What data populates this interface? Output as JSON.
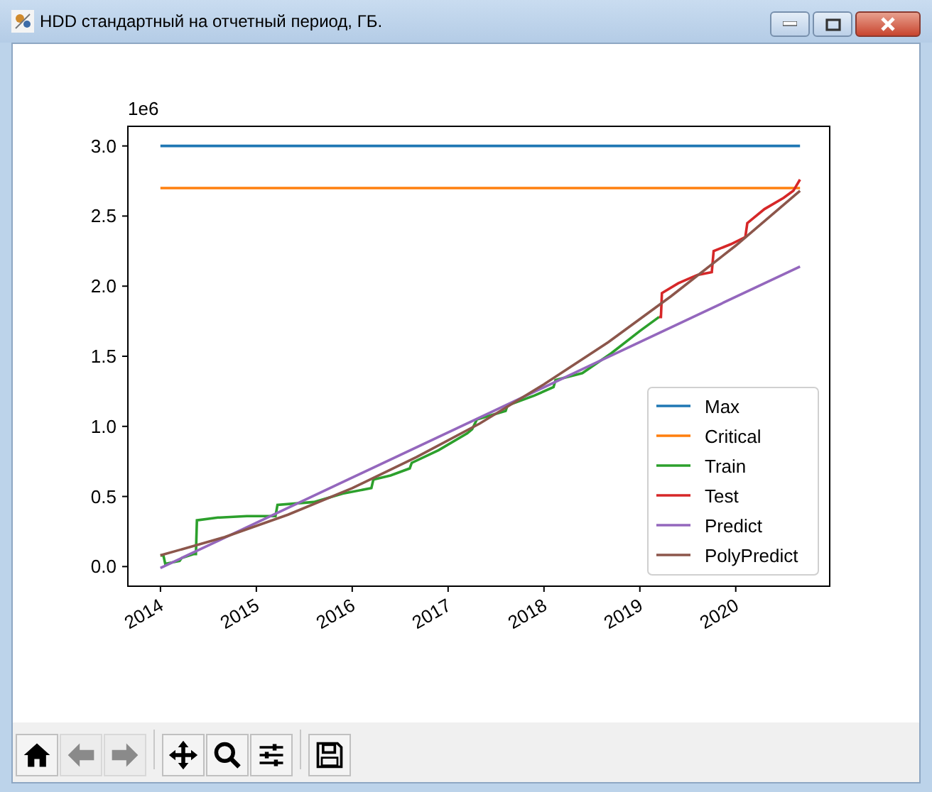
{
  "window": {
    "title": "HDD стандартный на отчетный период, ГБ."
  },
  "figure": {
    "offset_label": "1e6",
    "chart_data": {
      "type": "line",
      "xlim": [
        2013.66,
        2020.98
      ],
      "ylim": [
        -0.14,
        3.14
      ],
      "xticks": [
        {
          "value": 2014,
          "label": "2014"
        },
        {
          "value": 2015,
          "label": "2015"
        },
        {
          "value": 2016,
          "label": "2016"
        },
        {
          "value": 2017,
          "label": "2017"
        },
        {
          "value": 2018,
          "label": "2018"
        },
        {
          "value": 2019,
          "label": "2019"
        },
        {
          "value": 2020,
          "label": "2020"
        }
      ],
      "yticks": [
        {
          "value": 0,
          "label": "0.0"
        },
        {
          "value": 0.5,
          "label": "0.5"
        },
        {
          "value": 1,
          "label": "1.0"
        },
        {
          "value": 1.5,
          "label": "1.5"
        },
        {
          "value": 2,
          "label": "2.0"
        },
        {
          "value": 2.5,
          "label": "2.5"
        },
        {
          "value": 3,
          "label": "3.0"
        }
      ],
      "legend": true,
      "series": [
        {
          "name": "Max",
          "color": "#1f77b4",
          "x": [
            2014,
            2020.67
          ],
          "values": [
            3.0,
            3.0
          ]
        },
        {
          "name": "Critical",
          "color": "#ff7f0e",
          "x": [
            2014,
            2020.67
          ],
          "values": [
            2.7,
            2.7
          ]
        },
        {
          "name": "Train",
          "color": "#2ca02c",
          "x": [
            2014,
            2014.03,
            2014.05,
            2014.2,
            2014.22,
            2014.35,
            2014.37,
            2014.38,
            2014.6,
            2014.62,
            2014.9,
            2014.92,
            2015.2,
            2015.22,
            2015.6,
            2015.9,
            2016.2,
            2016.22,
            2016.4,
            2016.6,
            2016.62,
            2016.9,
            2017.2,
            2017.25,
            2017.3,
            2017.6,
            2017.62,
            2017.9,
            2018.1,
            2018.12,
            2018.4,
            2018.7,
            2019.0,
            2019.2
          ],
          "values": [
            0.08,
            0.08,
            0.02,
            0.04,
            0.06,
            0.09,
            0.09,
            0.33,
            0.35,
            0.35,
            0.36,
            0.36,
            0.36,
            0.44,
            0.46,
            0.52,
            0.56,
            0.62,
            0.65,
            0.7,
            0.74,
            0.83,
            0.95,
            0.98,
            1.05,
            1.11,
            1.15,
            1.22,
            1.28,
            1.33,
            1.38,
            1.52,
            1.68,
            1.78
          ]
        },
        {
          "name": "Test",
          "color": "#d62728",
          "x": [
            2019.2,
            2019.22,
            2019.23,
            2019.4,
            2019.6,
            2019.75,
            2019.77,
            2019.95,
            2020.1,
            2020.12,
            2020.3,
            2020.5,
            2020.6,
            2020.67
          ],
          "values": [
            1.78,
            1.78,
            1.95,
            2.02,
            2.08,
            2.1,
            2.25,
            2.3,
            2.35,
            2.45,
            2.55,
            2.63,
            2.68,
            2.76
          ]
        },
        {
          "name": "Predict",
          "color": "#9467bd",
          "x": [
            2014,
            2020.67
          ],
          "values": [
            -0.01,
            2.14
          ]
        },
        {
          "name": "PolyPredict",
          "color": "#8c564b",
          "x": [
            2014,
            2014.67,
            2015.33,
            2016,
            2016.67,
            2017.33,
            2018,
            2018.67,
            2019.33,
            2020,
            2020.67
          ],
          "values": [
            0.08,
            0.21,
            0.37,
            0.56,
            0.78,
            1.02,
            1.3,
            1.6,
            1.93,
            2.29,
            2.68
          ]
        }
      ]
    }
  },
  "toolbar": [
    {
      "kind": "home",
      "disabled": false
    },
    {
      "kind": "back",
      "disabled": true
    },
    {
      "kind": "forward",
      "disabled": true
    },
    {
      "kind": "separator"
    },
    {
      "kind": "pan",
      "disabled": false
    },
    {
      "kind": "zoom",
      "disabled": false
    },
    {
      "kind": "configure",
      "disabled": false
    },
    {
      "kind": "separator"
    },
    {
      "kind": "save",
      "disabled": false
    }
  ]
}
